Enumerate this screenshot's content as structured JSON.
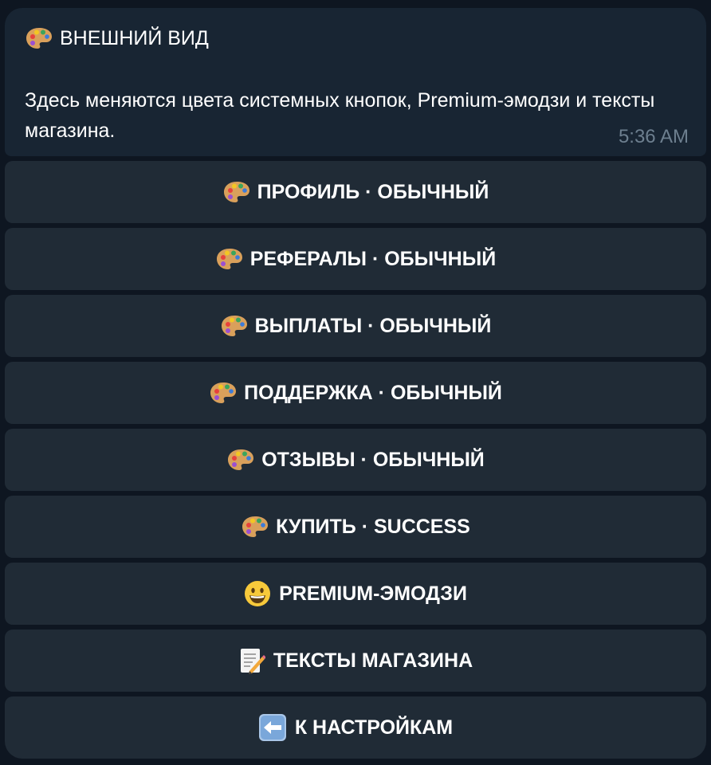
{
  "message": {
    "title": "ВНЕШНИЙ ВИД",
    "title_icon": "palette-icon",
    "text": "Здесь меняются цвета системных кнопок, Premium-эмодзи и тексты магазина.",
    "time": "5:36 AM"
  },
  "buttons": [
    {
      "label": "ПРОФИЛЬ · ОБЫЧНЫЙ",
      "icon": "palette-icon"
    },
    {
      "label": "РЕФЕРАЛЫ · ОБЫЧНЫЙ",
      "icon": "palette-icon"
    },
    {
      "label": "ВЫПЛАТЫ · ОБЫЧНЫЙ",
      "icon": "palette-icon"
    },
    {
      "label": "ПОДДЕРЖКА · ОБЫЧНЫЙ",
      "icon": "palette-icon"
    },
    {
      "label": "ОТЗЫВЫ · ОБЫЧНЫЙ",
      "icon": "palette-icon"
    },
    {
      "label": "КУПИТЬ · SUCCESS",
      "icon": "palette-icon"
    },
    {
      "label": "PREMIUM-ЭМОДЗИ",
      "icon": "grinning-face-icon"
    },
    {
      "label": "ТЕКСТЫ МАГАЗИНА",
      "icon": "memo-icon"
    },
    {
      "label": "К НАСТРОЙКАМ",
      "icon": "left-arrow-icon"
    }
  ],
  "colors": {
    "background": "#0e1621",
    "bubble": "#182533",
    "button": "#202b36",
    "time": "#6d7f8f"
  }
}
